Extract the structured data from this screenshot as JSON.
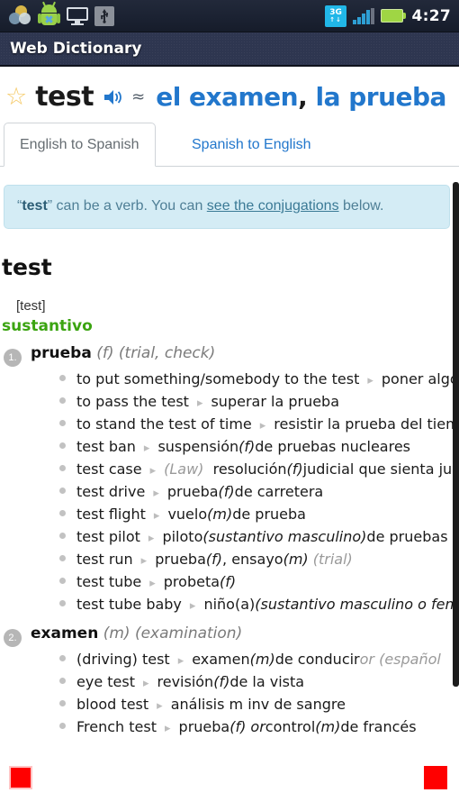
{
  "status_bar": {
    "icons_left": [
      "sync-icon",
      "android-robot-icon",
      "monitor-icon",
      "usb-icon"
    ],
    "network_label": "3G",
    "network_arrows": "↑↓",
    "icons_right": [
      "signal-icon",
      "battery-icon"
    ],
    "clock": "4:27"
  },
  "title_bar": {
    "title": "Web Dictionary"
  },
  "header": {
    "favorite_icon": "☆",
    "headword": "test",
    "speaker_icon": "speaker-icon",
    "approx_symbol": "≈",
    "translation_1": "el examen",
    "translation_separator": ",",
    "translation_2": " la prueba"
  },
  "tabs": [
    {
      "label": "English to Spanish",
      "active": true
    },
    {
      "label": "Spanish to English",
      "active": false
    }
  ],
  "note": {
    "quote_open": "“",
    "word": "test",
    "quote_close": "”",
    "text_before": " can be a verb. You can ",
    "link": "see the conjugations",
    "text_after": " below."
  },
  "entry": {
    "word": "test",
    "pronunciation": "[test]",
    "part_of_speech": "sustantivo",
    "senses": [
      {
        "number": "1.",
        "term": "prueba",
        "gender": "(f)",
        "gloss": "(trial, check)",
        "examples": [
          {
            "src": "to put something/somebody to the test",
            "label": "",
            "tgt": "poner algo/"
          },
          {
            "src": "to pass the test",
            "label": "",
            "tgt": "superar la prueba"
          },
          {
            "src": "to stand the test of time",
            "label": "",
            "tgt": "resistir la prueba del tiemp"
          },
          {
            "src": "test ban",
            "label": "",
            "tgt": "suspensión ",
            "tgt_it": "(f)",
            "tgt2": " de pruebas nucleares"
          },
          {
            "src": "test case",
            "label": "(Law)",
            "tgt": "resolución ",
            "tgt_it": "(f)",
            "tgt2": " judicial que sienta jur"
          },
          {
            "src": "test drive",
            "label": "",
            "tgt": "prueba ",
            "tgt_it": "(f)",
            "tgt2": " de carretera"
          },
          {
            "src": "test flight",
            "label": "",
            "tgt": "vuelo ",
            "tgt_it": "(m)",
            "tgt2": " de prueba"
          },
          {
            "src": "test pilot",
            "label": "",
            "tgt": "piloto ",
            "tgt_it": "(sustantivo masculino)",
            "tgt2": " de pruebas"
          },
          {
            "src": "test run",
            "label": "",
            "tgt": "prueba ",
            "tgt_it": "(f)",
            "tgt2": ", ensayo ",
            "tgt_it2": "(m)",
            "tgt_dim": "(trial)"
          },
          {
            "src": "test tube",
            "label": "",
            "tgt": "probeta ",
            "tgt_it": "(f)"
          },
          {
            "src": "test tube baby",
            "label": "",
            "tgt": "niño(a) ",
            "tgt_it": "(sustantivo masculino o fem"
          }
        ]
      },
      {
        "number": "2.",
        "term": "examen",
        "gender": "(m)",
        "gloss": "(examination)",
        "examples": [
          {
            "src": "(driving) test",
            "label": "",
            "tgt": "examen ",
            "tgt_it": "(m)",
            "tgt2": " de conducir ",
            "tgt_dim": "or (español"
          },
          {
            "src": "eye test",
            "label": "",
            "tgt": "revisión ",
            "tgt_it": "(f)",
            "tgt2": " de la vista"
          },
          {
            "src": "blood test",
            "label": "",
            "tgt": "análisis m inv de sangre"
          },
          {
            "src": "French test",
            "label": "",
            "tgt": "prueba ",
            "tgt_it": "(f) or",
            "tgt2": " control ",
            "tgt_it2": "(m)",
            "tgt3": " de francés"
          }
        ]
      }
    ]
  },
  "markers": [
    {
      "name": "red-square-left",
      "color": "#ff0000"
    },
    {
      "name": "red-square-right",
      "color": "#ff0000"
    }
  ],
  "colors": {
    "accent_blue": "#2277cc",
    "pos_green": "#3ba411",
    "note_bg": "#d4ecf5",
    "titlebar": "#2e3650",
    "statusbar": "#1b2232",
    "marker_red": "#ff0000"
  }
}
